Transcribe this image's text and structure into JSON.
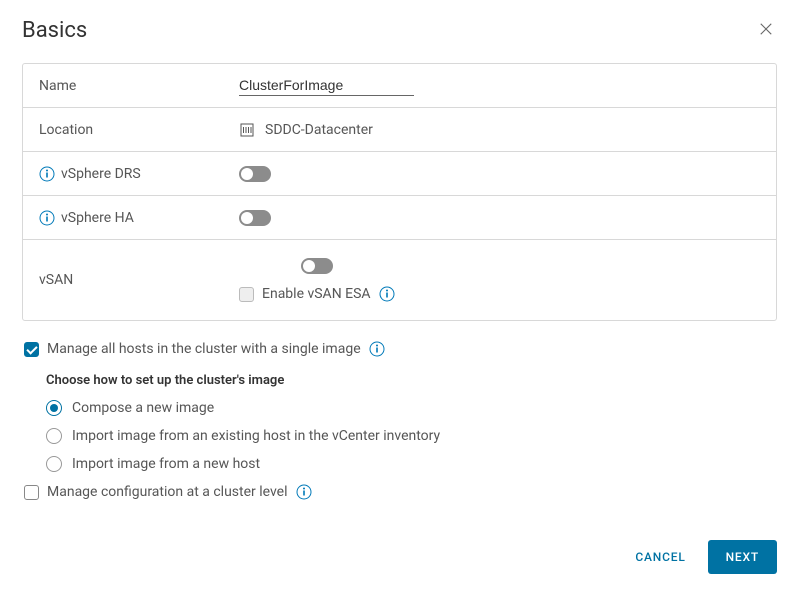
{
  "header": {
    "title": "Basics"
  },
  "form": {
    "name_label": "Name",
    "name_value": "ClusterForImage",
    "location_label": "Location",
    "location_value": "SDDC-Datacenter",
    "drs_label": "vSphere DRS",
    "ha_label": "vSphere HA",
    "vsan_label": "vSAN",
    "vsan_esa_label": "Enable vSAN ESA"
  },
  "image": {
    "manage_hosts_label": "Manage all hosts in the cluster with a single image",
    "sub_heading": "Choose how to set up the cluster's image",
    "radio_compose": "Compose a new image",
    "radio_import_existing": "Import image from an existing host in the vCenter inventory",
    "radio_import_new": "Import image from a new host",
    "manage_config_label": "Manage configuration at a cluster level"
  },
  "footer": {
    "cancel": "CANCEL",
    "next": "NEXT"
  }
}
